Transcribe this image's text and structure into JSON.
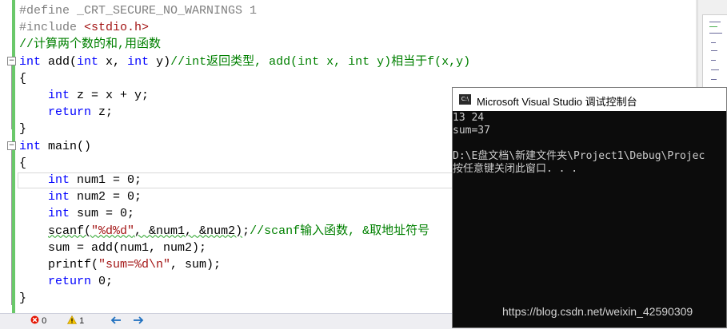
{
  "editor": {
    "lines": [
      {
        "parts": [
          {
            "c": "pp",
            "t": "#define "
          },
          {
            "c": "pp",
            "t": "_CRT_SECURE_NO_WARNINGS 1"
          }
        ]
      },
      {
        "parts": [
          {
            "c": "pp",
            "t": "#include "
          },
          {
            "c": "str",
            "t": "<stdio.h>"
          }
        ]
      },
      {
        "parts": [
          {
            "c": "cm",
            "t": "//计算两个数的和,用函数"
          }
        ]
      },
      {
        "parts": [
          {
            "c": "kw",
            "t": "int"
          },
          {
            "c": "fn",
            "t": " add("
          },
          {
            "c": "kw",
            "t": "int"
          },
          {
            "c": "fn",
            "t": " x, "
          },
          {
            "c": "kw",
            "t": "int"
          },
          {
            "c": "fn",
            "t": " y)"
          },
          {
            "c": "cm",
            "t": "//int返回类型, add(int x, int y)相当于f(x,y)"
          }
        ]
      },
      {
        "parts": [
          {
            "c": "fn",
            "t": "{"
          }
        ]
      },
      {
        "parts": [
          {
            "c": "fn",
            "t": "    "
          },
          {
            "c": "kw",
            "t": "int"
          },
          {
            "c": "fn",
            "t": " z = x + y;"
          }
        ]
      },
      {
        "parts": [
          {
            "c": "fn",
            "t": "    "
          },
          {
            "c": "kw",
            "t": "return"
          },
          {
            "c": "fn",
            "t": " z;"
          }
        ]
      },
      {
        "parts": [
          {
            "c": "fn",
            "t": "}"
          }
        ]
      },
      {
        "parts": [
          {
            "c": "kw",
            "t": "int"
          },
          {
            "c": "fn",
            "t": " main()"
          }
        ]
      },
      {
        "parts": [
          {
            "c": "fn",
            "t": "{"
          }
        ]
      },
      {
        "parts": [
          {
            "c": "fn",
            "t": "    "
          },
          {
            "c": "kw",
            "t": "int"
          },
          {
            "c": "fn",
            "t": " num1 = 0;"
          }
        ]
      },
      {
        "parts": [
          {
            "c": "fn",
            "t": "    "
          },
          {
            "c": "kw",
            "t": "int"
          },
          {
            "c": "fn",
            "t": " num2 = 0;"
          }
        ]
      },
      {
        "parts": [
          {
            "c": "fn",
            "t": "    "
          },
          {
            "c": "kw",
            "t": "int"
          },
          {
            "c": "fn",
            "t": " sum = 0;"
          }
        ]
      },
      {
        "parts": [
          {
            "c": "fn",
            "t": "    "
          },
          {
            "c": "fn squig",
            "t": "scanf("
          },
          {
            "c": "str squig",
            "t": "\"%d%d\""
          },
          {
            "c": "fn squig",
            "t": ", &num1, &num2)"
          },
          {
            "c": "fn",
            "t": ";"
          },
          {
            "c": "cm",
            "t": "//scanf输入函数, &取地址符号"
          }
        ]
      },
      {
        "parts": [
          {
            "c": "fn",
            "t": "    sum = add(num1, num2);"
          }
        ]
      },
      {
        "parts": [
          {
            "c": "fn",
            "t": "    printf("
          },
          {
            "c": "str",
            "t": "\"sum=%d\\n\""
          },
          {
            "c": "fn",
            "t": ", sum);"
          }
        ]
      },
      {
        "parts": [
          {
            "c": "fn",
            "t": "    "
          },
          {
            "c": "kw",
            "t": "return"
          },
          {
            "c": "fn",
            "t": " 0;"
          }
        ]
      },
      {
        "parts": [
          {
            "c": "fn",
            "t": "}"
          }
        ]
      }
    ]
  },
  "console": {
    "title": "Microsoft Visual Studio 调试控制台",
    "icon_text": "C:\\",
    "output": [
      "13 24",
      "sum=37",
      "",
      "D:\\E盘文档\\新建文件夹\\Project1\\Debug\\Projec",
      "按任意键关闭此窗口. . ."
    ]
  },
  "statusbar": {
    "errors": "0",
    "warnings": "1",
    "error_icon": "error-icon",
    "warning_icon": "warning-icon",
    "back_icon": "arrow-left-icon",
    "forward_icon": "arrow-right-icon"
  },
  "watermark": "https://blog.csdn.net/weixin_42590309",
  "colors": {
    "keyword": "#0000ff",
    "comment": "#008000",
    "string": "#a31515",
    "preprocessor": "#808080",
    "change_bar": "#6ac86a",
    "console_bg": "#0c0c0c"
  }
}
